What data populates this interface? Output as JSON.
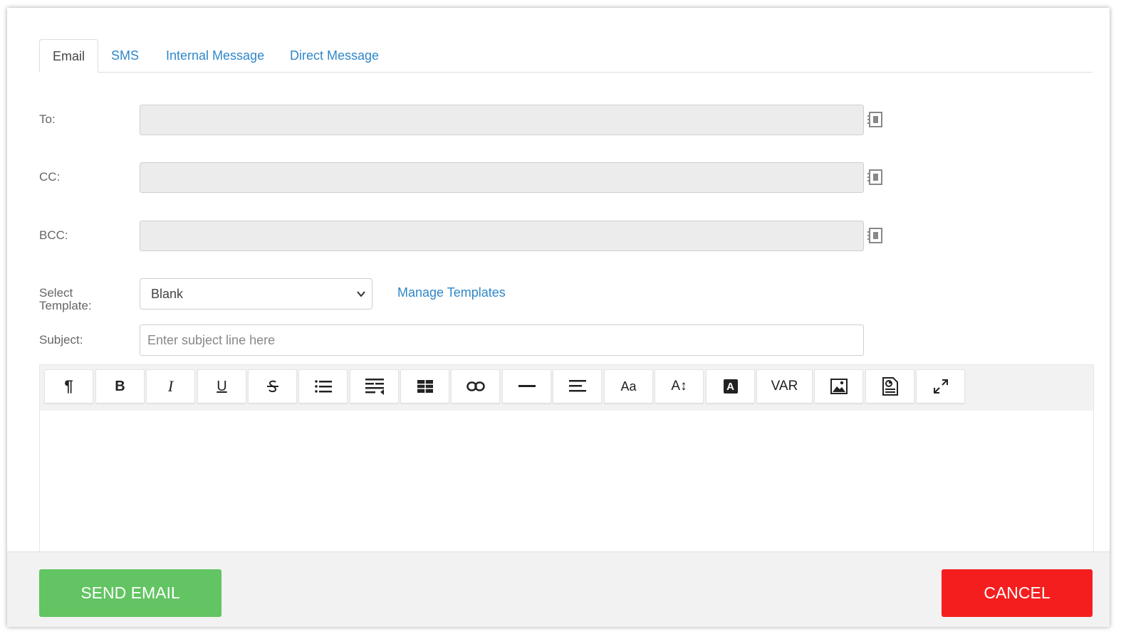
{
  "tabs": [
    {
      "label": "Email",
      "active": true
    },
    {
      "label": "SMS",
      "active": false
    },
    {
      "label": "Internal Message",
      "active": false
    },
    {
      "label": "Direct Message",
      "active": false
    }
  ],
  "fields": {
    "to_label": "To:",
    "cc_label": "CC:",
    "bcc_label": "BCC:",
    "to_value": "",
    "cc_value": "",
    "bcc_value": ""
  },
  "template": {
    "label_line1": "Select",
    "label_line2": "Template:",
    "selected": "Blank",
    "manage_link": "Manage Templates"
  },
  "subject": {
    "label": "Subject:",
    "placeholder": "Enter subject line here",
    "value": ""
  },
  "toolbar": {
    "buttons": [
      "paragraph",
      "bold",
      "italic",
      "underline",
      "strikethrough",
      "bulleted-list",
      "indent",
      "table",
      "link",
      "horizontal-rule",
      "align",
      "font-size",
      "line-height",
      "text-color",
      "VAR",
      "image",
      "document",
      "fullscreen"
    ],
    "bold_label": "B",
    "italic_label": "I",
    "underline_label": "U",
    "font_label": "Aa",
    "lineheight_label": "A",
    "color_label": "A",
    "var_label": "VAR",
    "paragraph_label": "¶"
  },
  "footer": {
    "send_label": "SEND EMAIL",
    "cancel_label": "CANCEL"
  },
  "colors": {
    "link": "#2f87c9",
    "send": "#62c462",
    "cancel": "#f51e1e"
  }
}
